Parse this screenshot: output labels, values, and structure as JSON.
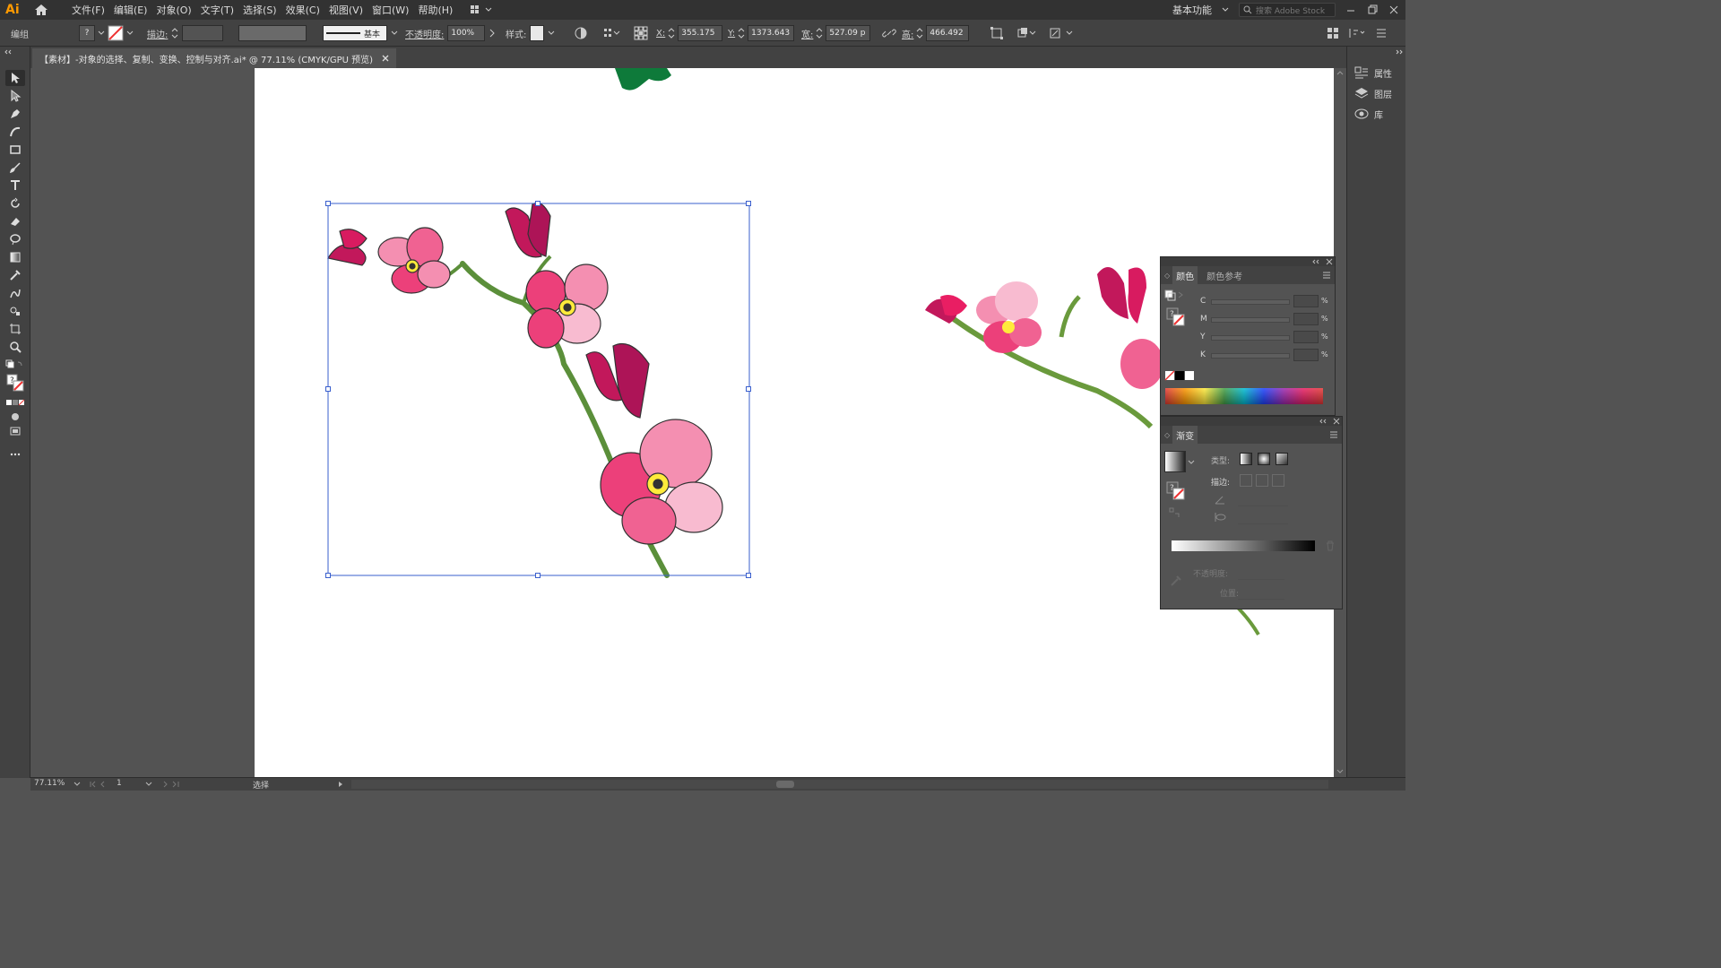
{
  "app": {
    "logo": "Ai"
  },
  "menu": {
    "items": [
      "文件(F)",
      "编辑(E)",
      "对象(O)",
      "文字(T)",
      "选择(S)",
      "效果(C)",
      "视图(V)",
      "窗口(W)",
      "帮助(H)"
    ]
  },
  "workspace": {
    "label": "基本功能",
    "search_placeholder": "搜索 Adobe Stock"
  },
  "control": {
    "group_label": "编组",
    "stroke_label": "描边:",
    "brush_label": "基本",
    "opacity_label": "不透明度:",
    "opacity_value": "100%",
    "style_label": "样式:",
    "x_label": "X:",
    "x_value": "355.175",
    "y_label": "Y:",
    "y_value": "1373.643",
    "w_label": "宽:",
    "w_value": "527.09 p",
    "h_label": "高:",
    "h_value": "466.492"
  },
  "document": {
    "tab_title": "【素材】-对象的选择、复制、变换、控制与对齐.ai* @ 77.11% (CMYK/GPU 预览)"
  },
  "right_panel": {
    "items": [
      "属性",
      "图层",
      "库"
    ]
  },
  "color_panel": {
    "tab_active": "颜色",
    "tab_inactive": "颜色参考",
    "channels": [
      "C",
      "M",
      "Y",
      "K"
    ],
    "percent": "%"
  },
  "gradient_panel": {
    "title": "渐变",
    "type_label": "类型:",
    "stroke_label": "描边:",
    "opacity_label": "不透明度:",
    "position_label": "位置:"
  },
  "status": {
    "zoom": "77.11%",
    "page": "1",
    "tool": "选择"
  },
  "colors": {
    "accent": "#ff9a00",
    "selection": "#3a5fcd",
    "petal": "#e8558f",
    "stem": "#6a9a3c"
  }
}
